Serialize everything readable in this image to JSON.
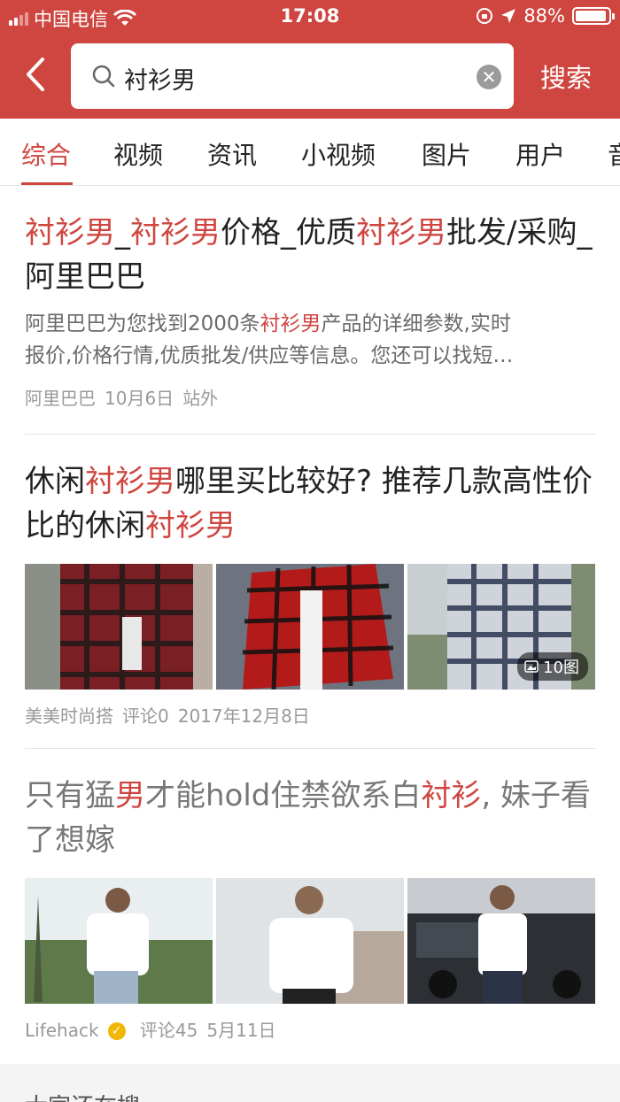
{
  "status_bar": {
    "carrier": "中国电信",
    "time": "17:08",
    "battery": "88%"
  },
  "search": {
    "query": "衬衫男",
    "button_label": "搜索",
    "clear_icon": "clear-icon"
  },
  "tabs": [
    {
      "label": "综合",
      "active": true
    },
    {
      "label": "视频"
    },
    {
      "label": "资讯"
    },
    {
      "label": "小视频"
    },
    {
      "label": "图片"
    },
    {
      "label": "用户"
    },
    {
      "label": "音"
    }
  ],
  "results": [
    {
      "title_parts": [
        "衬衫男",
        "_",
        "衬衫男",
        "价格_优质",
        "衬衫男",
        "批发/采购_阿里巴巴"
      ],
      "description_parts": [
        "阿里巴巴为您找到2000条",
        "衬衫男",
        "产品的详细参数,实时"
      ],
      "description_line2": "报价,价格行情,优质批发/供应等信息。您还可以找短…",
      "meta": {
        "source": "阿里巴巴",
        "date": "10月6日",
        "tag": "站外"
      }
    },
    {
      "title_parts": [
        "休闲",
        "衬衫男",
        "哪里买比较好? 推荐几款高性价比的休闲",
        "衬衫男"
      ],
      "image_count": "10图",
      "meta": {
        "source": "美美时尚搭",
        "comments": "评论0",
        "date": "2017年12月8日"
      }
    },
    {
      "title_parts": [
        "只有猛",
        "男",
        "才能hold住禁欲系白",
        "衬衫",
        ", 妹子看了想嫁"
      ],
      "meta": {
        "source": "Lifehack",
        "comments": "评论45",
        "date": "5月11日"
      }
    }
  ],
  "bottom": {
    "label": "大家还在搜"
  },
  "colors": {
    "brand": "#cf4640",
    "meta_gray": "#999999"
  }
}
